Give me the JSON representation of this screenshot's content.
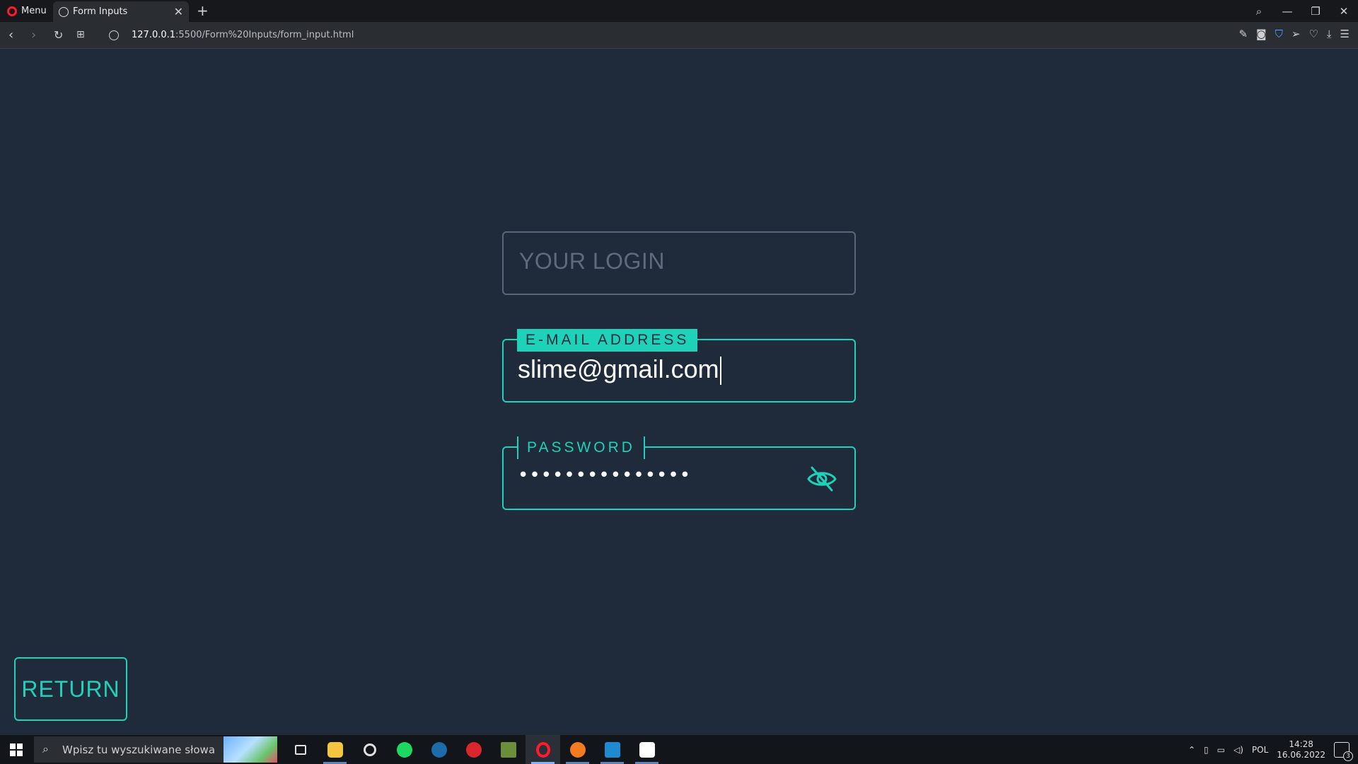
{
  "browser": {
    "menu_label": "Menu",
    "tab_title": "Form Inputs",
    "tab_close": "✕",
    "new_tab": "+",
    "url_host": "127.0.0.1",
    "url_path": ":5500/Form%20Inputs/form_input.html"
  },
  "form": {
    "login_placeholder": "YOUR LOGIN",
    "email_label": "E-MAIL ADDRESS",
    "email_value": "slime@gmail.com",
    "password_label": "PASSWORD",
    "password_masked": "•••••••••••••••"
  },
  "return_button": {
    "label": "RETURN"
  },
  "taskbar": {
    "search_placeholder": "Wpisz tu wyszukiwane słowa",
    "language": "POL",
    "time": "14:28",
    "date": "16.06.2022",
    "notification_count": "3"
  },
  "colors": {
    "accent": "#1ed1b9",
    "background": "#1f2a3a",
    "muted_border": "#5b6678"
  }
}
